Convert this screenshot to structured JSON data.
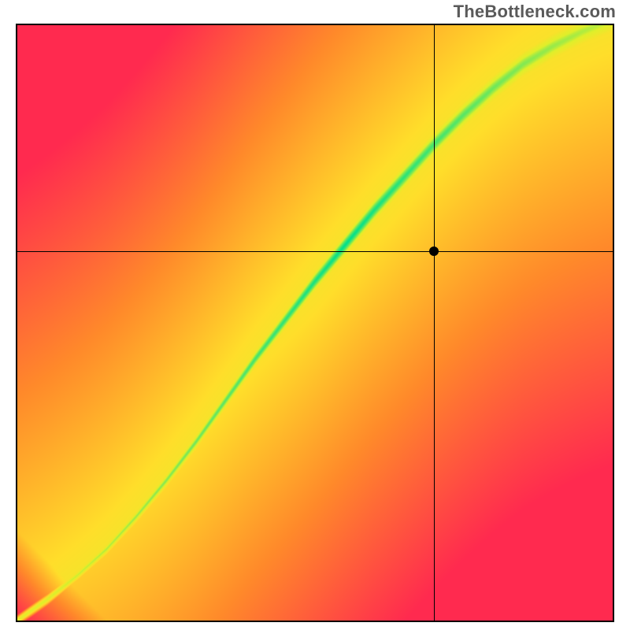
{
  "watermark": "TheBottleneck.com",
  "chart_data": {
    "type": "heatmap",
    "title": "",
    "xlabel": "",
    "ylabel": "",
    "xlim": [
      0,
      1
    ],
    "ylim": [
      0,
      1
    ],
    "grid": false,
    "legend": false,
    "color_scale": [
      {
        "offset": 0.0,
        "color": "#ff2a4f"
      },
      {
        "offset": 0.35,
        "color": "#ff8a2a"
      },
      {
        "offset": 0.65,
        "color": "#ffde2a"
      },
      {
        "offset": 0.82,
        "color": "#e0ef2a"
      },
      {
        "offset": 1.0,
        "color": "#00e08c"
      }
    ],
    "ridge": [
      {
        "x": 0.0,
        "y": 0.0
      },
      {
        "x": 0.05,
        "y": 0.035
      },
      {
        "x": 0.1,
        "y": 0.075
      },
      {
        "x": 0.15,
        "y": 0.12
      },
      {
        "x": 0.2,
        "y": 0.175
      },
      {
        "x": 0.25,
        "y": 0.235
      },
      {
        "x": 0.3,
        "y": 0.3
      },
      {
        "x": 0.35,
        "y": 0.37
      },
      {
        "x": 0.4,
        "y": 0.44
      },
      {
        "x": 0.45,
        "y": 0.505
      },
      {
        "x": 0.5,
        "y": 0.57
      },
      {
        "x": 0.55,
        "y": 0.63
      },
      {
        "x": 0.6,
        "y": 0.69
      },
      {
        "x": 0.65,
        "y": 0.745
      },
      {
        "x": 0.7,
        "y": 0.8
      },
      {
        "x": 0.75,
        "y": 0.85
      },
      {
        "x": 0.8,
        "y": 0.895
      },
      {
        "x": 0.85,
        "y": 0.935
      },
      {
        "x": 0.9,
        "y": 0.965
      },
      {
        "x": 0.95,
        "y": 0.99
      },
      {
        "x": 1.0,
        "y": 1.01
      }
    ],
    "ridge_halfwidth_min": 0.01,
    "ridge_halfwidth_max": 0.06,
    "background_range": 0.75,
    "marker": {
      "x": 0.7,
      "y": 0.62
    },
    "crosshair": {
      "x": 0.7,
      "y": 0.62
    }
  }
}
